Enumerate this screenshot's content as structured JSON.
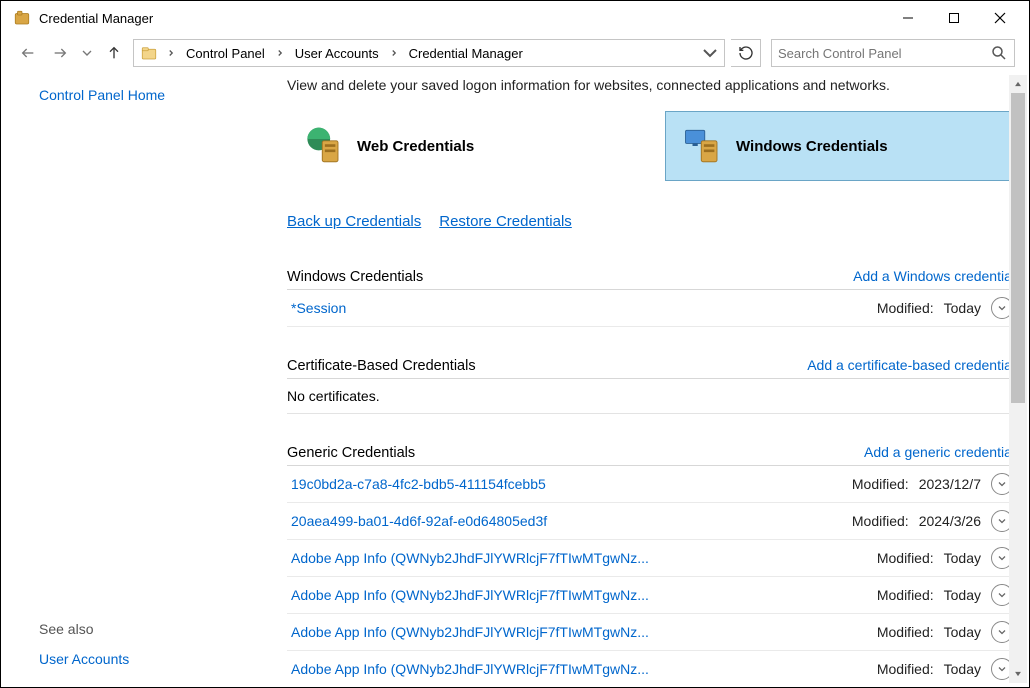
{
  "window": {
    "title": "Credential Manager"
  },
  "breadcrumbs": {
    "items": [
      {
        "label": "Control Panel"
      },
      {
        "label": "User Accounts"
      },
      {
        "label": "Credential Manager"
      }
    ]
  },
  "search": {
    "placeholder": "Search Control Panel"
  },
  "sidebar": {
    "home": "Control Panel Home",
    "see_also_hdr": "See also",
    "user_accounts": "User Accounts"
  },
  "main": {
    "description": "View and delete your saved logon information for websites, connected applications and networks.",
    "tiles": {
      "web": "Web Credentials",
      "windows": "Windows Credentials"
    },
    "links": {
      "backup": "Back up Credentials",
      "restore": "Restore Credentials"
    },
    "sections": {
      "windows": {
        "title": "Windows Credentials",
        "add": "Add a Windows credential",
        "items": [
          {
            "name": "*Session",
            "modified_label": "Modified:",
            "modified": "Today"
          }
        ]
      },
      "cert": {
        "title": "Certificate-Based Credentials",
        "add": "Add a certificate-based credential",
        "empty": "No certificates."
      },
      "generic": {
        "title": "Generic Credentials",
        "add": "Add a generic credential",
        "items": [
          {
            "name": "19c0bd2a-c7a8-4fc2-bdb5-411154fcebb5",
            "modified_label": "Modified:",
            "modified": "2023/12/7"
          },
          {
            "name": "20aea499-ba01-4d6f-92af-e0d64805ed3f",
            "modified_label": "Modified:",
            "modified": "2024/3/26"
          },
          {
            "name": "Adobe App Info (QWNyb2JhdFJlYWRlcjF7fTIwMTgwNz...",
            "modified_label": "Modified:",
            "modified": "Today"
          },
          {
            "name": "Adobe App Info (QWNyb2JhdFJlYWRlcjF7fTIwMTgwNz...",
            "modified_label": "Modified:",
            "modified": "Today"
          },
          {
            "name": "Adobe App Info (QWNyb2JhdFJlYWRlcjF7fTIwMTgwNz...",
            "modified_label": "Modified:",
            "modified": "Today"
          },
          {
            "name": "Adobe App Info (QWNyb2JhdFJlYWRlcjF7fTIwMTgwNz...",
            "modified_label": "Modified:",
            "modified": "Today"
          }
        ]
      }
    }
  }
}
